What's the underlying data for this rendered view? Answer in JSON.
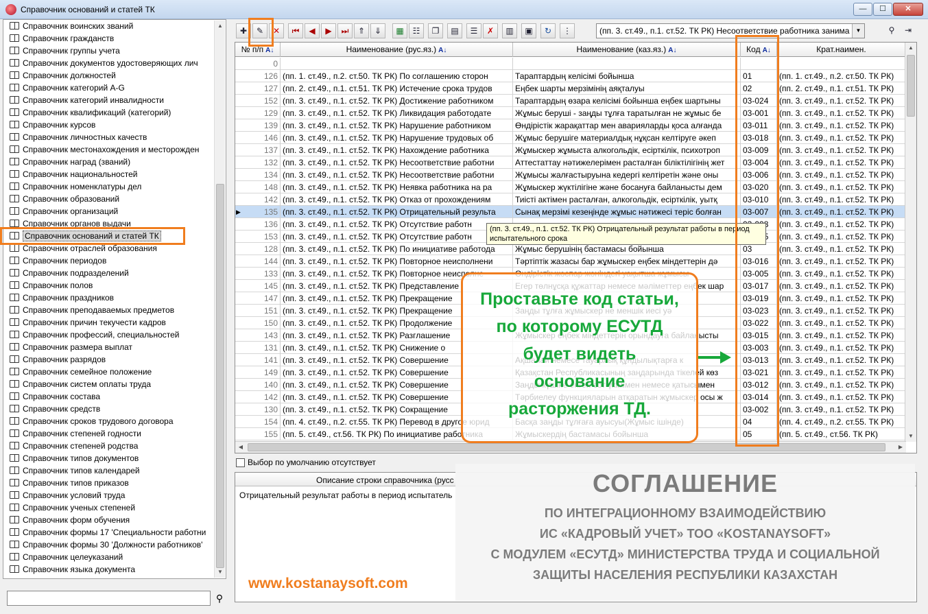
{
  "window": {
    "title": "Справочник оснований и статей ТК",
    "min_label": "—",
    "max_label": "☐",
    "close_label": "✕"
  },
  "left": {
    "items": [
      "Справочник воинских званий",
      "Справочник гражданств",
      "Справочник группы учета",
      "Справочник документов удостоверяющих лич",
      "Справочник должностей",
      "Справочник категорий A-G",
      "Справочник категорий инвалидности",
      "Справочник квалификаций (категорий)",
      "Справочник курсов",
      "Справочник личностных качеств",
      "Справочник местонахождения и месторожден",
      "Справочник наград (званий)",
      "Справочник национальностей",
      "Справочник номенклатуры дел",
      "Справочник образований",
      "Справочник организаций",
      "Справочник органов выдачи",
      "Справочник оснований и статей ТК",
      "Справочник отраслей образования",
      "Справочник периодов",
      "Справочник подразделений",
      "Справочник полов",
      "Справочник праздников",
      "Справочник преподаваемых предметов",
      "Справочник причин текучести кадров",
      "Справочник профессий, специальностей",
      "Справочник размера выплат",
      "Справочник разрядов",
      "Справочник семейное положение",
      "Справочник систем оплаты труда",
      "Справочник состава",
      "Справочник средств",
      "Справочник сроков трудового договора",
      "Справочник степеней годности",
      "Справочник степеней родства",
      "Справочник типов документов",
      "Справочник типов календарей",
      "Справочник типов приказов",
      "Справочник условий труда",
      "Справочник ученых степеней",
      "Справочник форм обучения",
      "Справочник формы 17 'Специальности работни",
      "Справочник формы 30 'Должности работников'",
      "Справочник целеуказаний",
      "Справочник языка документа"
    ],
    "selected_index": 17,
    "search_value": ""
  },
  "toolbar": {
    "buttons": [
      "add",
      "edit",
      "delete",
      "first",
      "prev",
      "next",
      "last",
      "b8",
      "b9",
      "excel",
      "b11",
      "copy",
      "paste",
      "b14",
      "b15",
      "barcode",
      "b17",
      "refresh",
      "b19"
    ],
    "combo_value": "(пп. 3. ст.49., п.1. ст.52. ТК РК) Несоответствие работника занима",
    "search_icon": "binoculars-icon",
    "exit_icon": "exit-icon"
  },
  "grid": {
    "headers": {
      "num": "№ п/п",
      "name_ru": "Наименование (рус.яз.)",
      "name_kz": "Наименование (каз.яз.)",
      "code": "Код",
      "short": "Крат.наимен."
    },
    "rows": [
      {
        "num": "0",
        "ru": "",
        "kz": "",
        "code": "",
        "short": ""
      },
      {
        "num": "126",
        "ru": "(пп. 1. ст.49., п.2. ст.50. ТК РК) По соглашению сторон",
        "kz": "Тараптардың келісімі бойынша",
        "code": "01",
        "short": "(пп. 1. ст.49., п.2. ст.50. ТК РК)"
      },
      {
        "num": "127",
        "ru": "(пп. 2. ст.49., п.1. ст.51. ТК РК) Истечение срока трудов",
        "kz": "Еңбек шарты мерзімінің аяқталуы",
        "code": "02",
        "short": "(пп. 2. ст.49., п.1. ст.51. ТК РК)"
      },
      {
        "num": "152",
        "ru": "(пп. 3. ст.49., п.1. ст.52. ТК РК) Достижение работником",
        "kz": "Тараптардың өзара келісімі бойынша еңбек шартыны",
        "code": "03-024",
        "short": "(пп. 3. ст.49., п.1. ст.52. ТК РК)"
      },
      {
        "num": "129",
        "ru": "(пп. 3. ст.49., п.1. ст.52. ТК РК) Ликвидация работодате",
        "kz": "Жұмыс беруші - заңды тұлға таратылған не жұмыс бе",
        "code": "03-001",
        "short": "(пп. 3. ст.49., п.1. ст.52. ТК РК)"
      },
      {
        "num": "139",
        "ru": "(пп. 3. ст.49., п.1. ст.52. ТК РК) Нарушение работником",
        "kz": "Өндірістік жарақаттар мен аварияларды қоса алғанда",
        "code": "03-011",
        "short": "(пп. 3. ст.49., п.1. ст.52. ТК РК)"
      },
      {
        "num": "146",
        "ru": "(пп. 3. ст.49., п.1. ст.52. ТК РК) Нарушение трудовых об",
        "kz": "Жұмыс берушіге материалдық нұқсан келтіруге әкеп",
        "code": "03-018",
        "short": "(пп. 3. ст.49., п.1. ст.52. ТК РК)"
      },
      {
        "num": "137",
        "ru": "(пп. 3. ст.49., п.1. ст.52. ТК РК) Нахождение работника",
        "kz": "Жұмыскер жұмыста алкогольдік, есірткілік, психотроп",
        "code": "03-009",
        "short": "(пп. 3. ст.49., п.1. ст.52. ТК РК)"
      },
      {
        "num": "132",
        "ru": "(пп. 3. ст.49., п.1. ст.52. ТК РК) Несоответствие работни",
        "kz": "Аттестаттау нәтижелерімен расталған біліктілігінің жет",
        "code": "03-004",
        "short": "(пп. 3. ст.49., п.1. ст.52. ТК РК)"
      },
      {
        "num": "134",
        "ru": "(пп. 3. ст.49., п.1. ст.52. ТК РК) Несоответствие работни",
        "kz": "Жұмысы жалғастыруына кедергі келтіретін және оны",
        "code": "03-006",
        "short": "(пп. 3. ст.49., п.1. ст.52. ТК РК)"
      },
      {
        "num": "148",
        "ru": "(пп. 3. ст.49., п.1. ст.52. ТК РК) Неявка работника на ра",
        "kz": "Жұмыскер жүктілігіне және босануға байланысты дем",
        "code": "03-020",
        "short": "(пп. 3. ст.49., п.1. ст.52. ТК РК)"
      },
      {
        "num": "142",
        "ru": "(пп. 3. ст.49., п.1. ст.52. ТК РК) Отказ от прохождениям",
        "kz": "Тиісті актімен расталған, алкогольдік, есірткілік, уытқ",
        "code": "03-010",
        "short": "(пп. 3. ст.49., п.1. ст.52. ТК РК)"
      },
      {
        "num": "135",
        "ru": "(пп. 3. ст.49., п.1. ст.52. ТК РК) Отрицательный результа",
        "kz": "Сынақ мерзімі кезеңінде жұмыс нәтижесі теріс болған",
        "code": "03-007",
        "short": "(пп. 3. ст.49., п.1. ст.52. ТК РК)"
      },
      {
        "num": "136",
        "ru": "(пп. 3. ст.49., п.1. ст.52. ТК РК) Отсутствие работн",
        "kz": "",
        "code": "03-008",
        "short": "(пп. 3. ст.49., п.1. ст.52. ТК РК)"
      },
      {
        "num": "153",
        "ru": "(пп. 3. ст.49., п.1. ст.52. ТК РК) Отсутствие работн",
        "kz": "",
        "code": "03-025",
        "short": "(пп. 3. ст.49., п.1. ст.52. ТК РК)"
      },
      {
        "num": "128",
        "ru": "(пп. 3. ст.49., п.1. ст.52. ТК РК) По инициативе работода",
        "kz": "Жұмыс берушінің бастамасы бойынша",
        "code": "03",
        "short": "(пп. 3. ст.49., п.1. ст.52. ТК РК)"
      },
      {
        "num": "144",
        "ru": "(пп. 3. ст.49., п.1. ст.52. ТК РК) Повторное неисполнени",
        "kz": "Тәртіптік жазасы бар жұмыскер еңбек міндеттерін дә",
        "code": "03-016",
        "short": "(пп. 3. ст.49., п.1. ст.52. ТК РК)"
      },
      {
        "num": "133",
        "ru": "(пп. 3. ст.49., п.1. ст.52. ТК РК) Повторное неисполне",
        "kz": "Өндірістік жоспар жөніндегі уақытша жұмысы",
        "code": "03-005",
        "short": "(пп. 3. ст.49., п.1. ст.52. ТК РК)"
      },
      {
        "num": "145",
        "ru": "(пп. 3. ст.49., п.1. ст.52. ТК РК) Представление",
        "kz": "Егер төлнұсқа құжаттар немесе мәліметтер еңбек шар",
        "code": "03-017",
        "short": "(пп. 3. ст.49., п.1. ст.52. ТК РК)"
      },
      {
        "num": "147",
        "ru": "(пп. 3. ст.49., п.1. ст.52. ТК РК) Прекращение",
        "kz": "",
        "code": "03-019",
        "short": "(пп. 3. ст.49., п.1. ст.52. ТК РК)"
      },
      {
        "num": "151",
        "ru": "(пп. 3. ст.49., п.1. ст.52. ТК РК) Прекращение",
        "kz": "Заңды тұлға жұмыскер не меншік иесі уә",
        "code": "03-023",
        "short": "(пп. 3. ст.49., п.1. ст.52. ТК РК)"
      },
      {
        "num": "150",
        "ru": "(пп. 3. ст.49., п.1. ст.52. ТК РК) Продолжение",
        "kz": "",
        "code": "03-022",
        "short": "(пп. 3. ст.49., п.1. ст.52. ТК РК)"
      },
      {
        "num": "143",
        "ru": "(пп. 3. ст.49., п.1. ст.52. ТК РК) Разглашение",
        "kz": "Жұмыскер еңбек міндеттерін орындауға байланысты",
        "code": "03-015",
        "short": "(пп. 3. ст.49., п.1. ст.52. ТК РК)"
      },
      {
        "num": "131",
        "ru": "(пп. 3. ст.49., п.1. ст.52. ТК РК) Снижение о",
        "kz": "",
        "code": "03-003",
        "short": "(пп. 3. ст.49., п.1. ст.52. ТК РК)"
      },
      {
        "num": "141",
        "ru": "(пп. 3. ст.49., п.1. ст.52. ТК РК) Совершение",
        "kz": "Ақшалай немесе тауарлық құндылықтарға к",
        "code": "03-013",
        "short": "(пп. 3. ст.49., п.1. ст.52. ТК РК)"
      },
      {
        "num": "149",
        "ru": "(пп. 3. ст.49., п.1. ст.52. ТК РК) Совершение",
        "kz": "Қазақстан Республикасының заңдарында тікелей көз",
        "code": "03-021",
        "short": "(пп. 3. ст.49., п.1. ст.52. ТК РК)"
      },
      {
        "num": "140",
        "ru": "(пп. 3. ст.49., п.1. ст.52. ТК РК) Совершение",
        "kz": "Заңды күшіне енген сот үкімімен немесе қатысымен",
        "code": "03-012",
        "short": "(пп. 3. ст.49., п.1. ст.52. ТК РК)"
      },
      {
        "num": "142",
        "ru": "(пп. 3. ст.49., п.1. ст.52. ТК РК) Совершение",
        "kz": "Тәрбиелеу функцияларын атқаратын жұмыскер осы ж",
        "code": "03-014",
        "short": "(пп. 3. ст.49., п.1. ст.52. ТК РК)"
      },
      {
        "num": "130",
        "ru": "(пп. 3. ст.49., п.1. ст.52. ТК РК) Сокращение",
        "kz": "",
        "code": "03-002",
        "short": "(пп. 3. ст.49., п.1. ст.52. ТК РК)"
      },
      {
        "num": "154",
        "ru": "(пп. 4. ст.49., п.2. ст.55. ТК РК) Перевод в другое юрид",
        "kz": "Басқа заңды тұлғаға ауысуы(Жұмыс ішінде)",
        "code": "04",
        "short": "(пп. 4. ст.49., п.2. ст.55. ТК РК)"
      },
      {
        "num": "155",
        "ru": "(пп. 5. ст.49., ст.56. ТК РК) По инициативе работника",
        "kz": "Жұмыскердің бастамасы бойынша",
        "code": "05",
        "short": "(пп. 5. ст.49., ст.56. ТК РК)"
      }
    ],
    "selected_index": 12,
    "tooltip": "(пп. 3. ст.49., п.1. ст.52. ТК РК) Отрицательный результат работы в период испытательного срока"
  },
  "default_checkbox_label": "Выбор по умолчанию отсутствует",
  "description": {
    "title": "Описание строки справочника (русс",
    "text": "Отрицательный результат работы в период испытатель"
  },
  "callout": {
    "lines": [
      "Проставьте код статьи,",
      "по которому ЕСУТД",
      "будет видеть",
      "основание",
      "расторжения ТД."
    ],
    "color": "#17a83a",
    "border_color": "#f07d1e"
  },
  "agreement": {
    "title": "СОГЛАШЕНИЕ",
    "lines": [
      "ПО ИНТЕГРАЦИОННОМУ ВЗАИМОДЕЙСТВИЮ",
      "ИС «КАДРОВЫЙ УЧЕТ» ТОО «KOSTANAYSOFT»",
      "С МОДУЛЕМ «ЕСУТД» МИНИСТЕРСТВА  ТРУДА И СОЦИАЛЬНОЙ",
      "ЗАЩИТЫ НАСЕЛЕНИЯ РЕСПУБЛИКИ КАЗАХСТАН"
    ]
  },
  "website": "www.kostanaysoft.com",
  "colors": {
    "accent_orange": "#f07d1e",
    "selected_row": "#c6dcf5",
    "callout_green": "#17a83a"
  }
}
